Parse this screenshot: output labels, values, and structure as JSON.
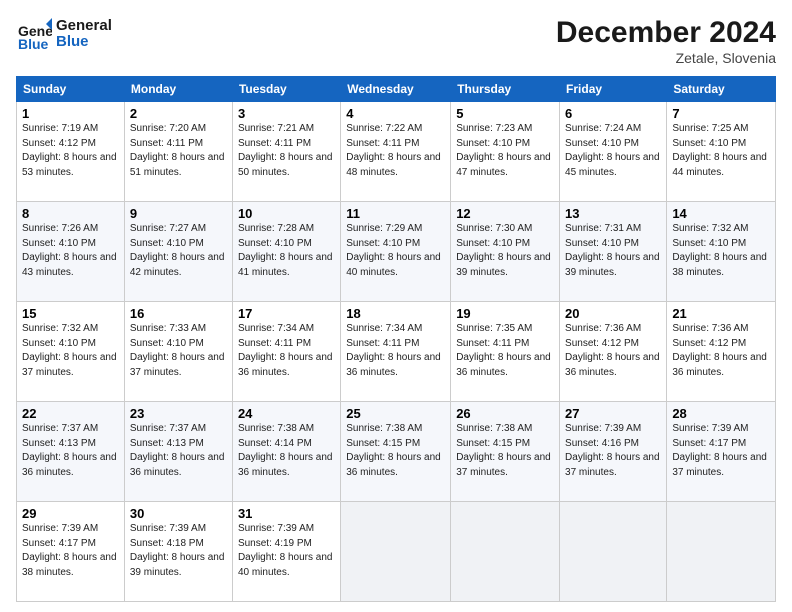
{
  "logo": {
    "line1": "General",
    "line2": "Blue"
  },
  "title": "December 2024",
  "subtitle": "Zetale, Slovenia",
  "weekdays": [
    "Sunday",
    "Monday",
    "Tuesday",
    "Wednesday",
    "Thursday",
    "Friday",
    "Saturday"
  ],
  "weeks": [
    [
      {
        "day": "1",
        "sunrise": "Sunrise: 7:19 AM",
        "sunset": "Sunset: 4:12 PM",
        "daylight": "Daylight: 8 hours and 53 minutes."
      },
      {
        "day": "2",
        "sunrise": "Sunrise: 7:20 AM",
        "sunset": "Sunset: 4:11 PM",
        "daylight": "Daylight: 8 hours and 51 minutes."
      },
      {
        "day": "3",
        "sunrise": "Sunrise: 7:21 AM",
        "sunset": "Sunset: 4:11 PM",
        "daylight": "Daylight: 8 hours and 50 minutes."
      },
      {
        "day": "4",
        "sunrise": "Sunrise: 7:22 AM",
        "sunset": "Sunset: 4:11 PM",
        "daylight": "Daylight: 8 hours and 48 minutes."
      },
      {
        "day": "5",
        "sunrise": "Sunrise: 7:23 AM",
        "sunset": "Sunset: 4:10 PM",
        "daylight": "Daylight: 8 hours and 47 minutes."
      },
      {
        "day": "6",
        "sunrise": "Sunrise: 7:24 AM",
        "sunset": "Sunset: 4:10 PM",
        "daylight": "Daylight: 8 hours and 45 minutes."
      },
      {
        "day": "7",
        "sunrise": "Sunrise: 7:25 AM",
        "sunset": "Sunset: 4:10 PM",
        "daylight": "Daylight: 8 hours and 44 minutes."
      }
    ],
    [
      {
        "day": "8",
        "sunrise": "Sunrise: 7:26 AM",
        "sunset": "Sunset: 4:10 PM",
        "daylight": "Daylight: 8 hours and 43 minutes."
      },
      {
        "day": "9",
        "sunrise": "Sunrise: 7:27 AM",
        "sunset": "Sunset: 4:10 PM",
        "daylight": "Daylight: 8 hours and 42 minutes."
      },
      {
        "day": "10",
        "sunrise": "Sunrise: 7:28 AM",
        "sunset": "Sunset: 4:10 PM",
        "daylight": "Daylight: 8 hours and 41 minutes."
      },
      {
        "day": "11",
        "sunrise": "Sunrise: 7:29 AM",
        "sunset": "Sunset: 4:10 PM",
        "daylight": "Daylight: 8 hours and 40 minutes."
      },
      {
        "day": "12",
        "sunrise": "Sunrise: 7:30 AM",
        "sunset": "Sunset: 4:10 PM",
        "daylight": "Daylight: 8 hours and 39 minutes."
      },
      {
        "day": "13",
        "sunrise": "Sunrise: 7:31 AM",
        "sunset": "Sunset: 4:10 PM",
        "daylight": "Daylight: 8 hours and 39 minutes."
      },
      {
        "day": "14",
        "sunrise": "Sunrise: 7:32 AM",
        "sunset": "Sunset: 4:10 PM",
        "daylight": "Daylight: 8 hours and 38 minutes."
      }
    ],
    [
      {
        "day": "15",
        "sunrise": "Sunrise: 7:32 AM",
        "sunset": "Sunset: 4:10 PM",
        "daylight": "Daylight: 8 hours and 37 minutes."
      },
      {
        "day": "16",
        "sunrise": "Sunrise: 7:33 AM",
        "sunset": "Sunset: 4:10 PM",
        "daylight": "Daylight: 8 hours and 37 minutes."
      },
      {
        "day": "17",
        "sunrise": "Sunrise: 7:34 AM",
        "sunset": "Sunset: 4:11 PM",
        "daylight": "Daylight: 8 hours and 36 minutes."
      },
      {
        "day": "18",
        "sunrise": "Sunrise: 7:34 AM",
        "sunset": "Sunset: 4:11 PM",
        "daylight": "Daylight: 8 hours and 36 minutes."
      },
      {
        "day": "19",
        "sunrise": "Sunrise: 7:35 AM",
        "sunset": "Sunset: 4:11 PM",
        "daylight": "Daylight: 8 hours and 36 minutes."
      },
      {
        "day": "20",
        "sunrise": "Sunrise: 7:36 AM",
        "sunset": "Sunset: 4:12 PM",
        "daylight": "Daylight: 8 hours and 36 minutes."
      },
      {
        "day": "21",
        "sunrise": "Sunrise: 7:36 AM",
        "sunset": "Sunset: 4:12 PM",
        "daylight": "Daylight: 8 hours and 36 minutes."
      }
    ],
    [
      {
        "day": "22",
        "sunrise": "Sunrise: 7:37 AM",
        "sunset": "Sunset: 4:13 PM",
        "daylight": "Daylight: 8 hours and 36 minutes."
      },
      {
        "day": "23",
        "sunrise": "Sunrise: 7:37 AM",
        "sunset": "Sunset: 4:13 PM",
        "daylight": "Daylight: 8 hours and 36 minutes."
      },
      {
        "day": "24",
        "sunrise": "Sunrise: 7:38 AM",
        "sunset": "Sunset: 4:14 PM",
        "daylight": "Daylight: 8 hours and 36 minutes."
      },
      {
        "day": "25",
        "sunrise": "Sunrise: 7:38 AM",
        "sunset": "Sunset: 4:15 PM",
        "daylight": "Daylight: 8 hours and 36 minutes."
      },
      {
        "day": "26",
        "sunrise": "Sunrise: 7:38 AM",
        "sunset": "Sunset: 4:15 PM",
        "daylight": "Daylight: 8 hours and 37 minutes."
      },
      {
        "day": "27",
        "sunrise": "Sunrise: 7:39 AM",
        "sunset": "Sunset: 4:16 PM",
        "daylight": "Daylight: 8 hours and 37 minutes."
      },
      {
        "day": "28",
        "sunrise": "Sunrise: 7:39 AM",
        "sunset": "Sunset: 4:17 PM",
        "daylight": "Daylight: 8 hours and 37 minutes."
      }
    ],
    [
      {
        "day": "29",
        "sunrise": "Sunrise: 7:39 AM",
        "sunset": "Sunset: 4:17 PM",
        "daylight": "Daylight: 8 hours and 38 minutes."
      },
      {
        "day": "30",
        "sunrise": "Sunrise: 7:39 AM",
        "sunset": "Sunset: 4:18 PM",
        "daylight": "Daylight: 8 hours and 39 minutes."
      },
      {
        "day": "31",
        "sunrise": "Sunrise: 7:39 AM",
        "sunset": "Sunset: 4:19 PM",
        "daylight": "Daylight: 8 hours and 40 minutes."
      },
      null,
      null,
      null,
      null
    ]
  ]
}
